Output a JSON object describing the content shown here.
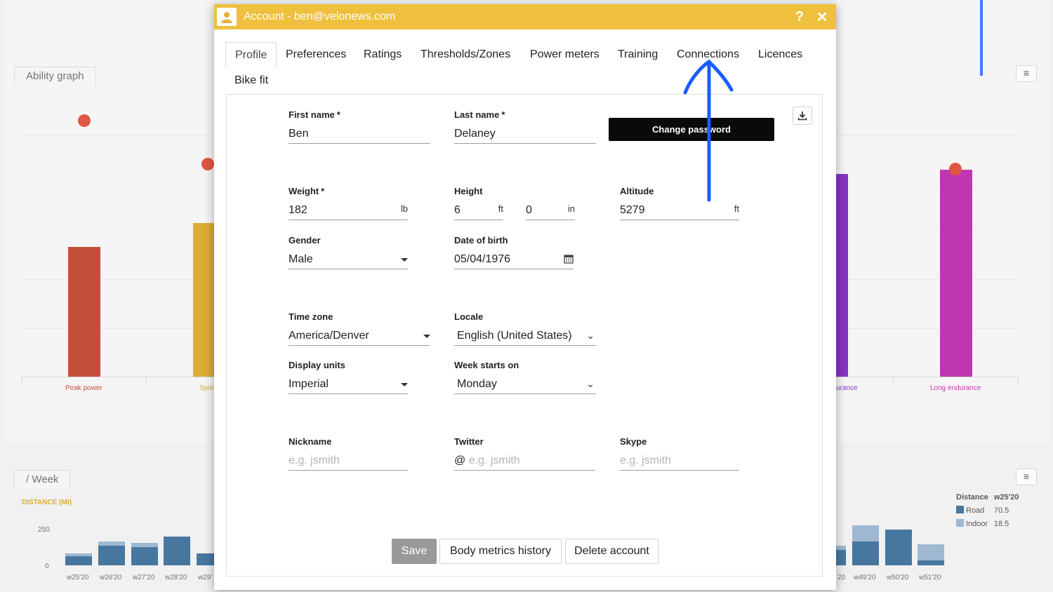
{
  "background": {
    "panel_tab": "Ability graph",
    "week_tab": "/ Week",
    "week_metric_label": "DISTANCE (MI)",
    "y_ticks": [
      "250",
      "0"
    ],
    "ability_chart": {
      "categories": [
        "Peak power",
        "Sprint",
        "Endurance",
        "Long endurance"
      ],
      "visible_labels": [
        "Peak power",
        "Sprin",
        "urance",
        "Long endurance"
      ],
      "colors": [
        "#b82a10",
        "#d29b0c",
        "#6b09b4",
        "#b00c9f"
      ]
    },
    "weeks_left": [
      "w25'20",
      "w26'20",
      "w27'20",
      "w28'20",
      "w29'"
    ],
    "weeks_right": [
      "20",
      "w49'20",
      "w50'20",
      "w51'20"
    ],
    "legend": {
      "header": [
        "Distance",
        "w25'20"
      ],
      "rows": [
        {
          "name": "Road",
          "value": "70.5",
          "color": "#1f5a8a"
        },
        {
          "name": "Indoor",
          "value": "18.5",
          "color": "#8aa9c7"
        }
      ]
    }
  },
  "dialog": {
    "title": "Account - ben@velonews.com",
    "help": "?",
    "close": "✕",
    "tabs": [
      "Profile",
      "Preferences",
      "Ratings",
      "Thresholds/Zones",
      "Power meters",
      "Training",
      "Connections",
      "Licences",
      "Bike fit"
    ],
    "active_tab": "Profile",
    "change_password": "Change password",
    "fields": {
      "first_name": {
        "label": "First name",
        "value": "Ben",
        "required": "*"
      },
      "last_name": {
        "label": "Last name",
        "value": "Delaney",
        "required": "*"
      },
      "weight": {
        "label": "Weight",
        "value": "182",
        "unit": "lb",
        "required": "*"
      },
      "height": {
        "label": "Height",
        "ft_value": "6",
        "ft_unit": "ft",
        "in_value": "0",
        "in_unit": "in"
      },
      "altitude": {
        "label": "Altitude",
        "value": "5279",
        "unit": "ft"
      },
      "gender": {
        "label": "Gender",
        "value": "Male"
      },
      "dob": {
        "label": "Date of birth",
        "value": "05/04/1976"
      },
      "timezone": {
        "label": "Time zone",
        "value": "America/Denver"
      },
      "locale": {
        "label": "Locale",
        "value": "English (United States)"
      },
      "display_units": {
        "label": "Display units",
        "value": "Imperial"
      },
      "week_start": {
        "label": "Week starts on",
        "value": "Monday"
      },
      "nickname": {
        "label": "Nickname",
        "placeholder": "e.g. jsmith"
      },
      "twitter": {
        "label": "Twitter",
        "prefix": "@",
        "placeholder": "e.g. jsmith"
      },
      "skype": {
        "label": "Skype",
        "placeholder": "e.g. jsmith"
      }
    },
    "buttons": {
      "save": "Save",
      "body_metrics": "Body metrics history",
      "delete": "Delete account"
    }
  },
  "colors": {
    "titlebar": "#efc03e",
    "annotation": "#1a5cff"
  }
}
